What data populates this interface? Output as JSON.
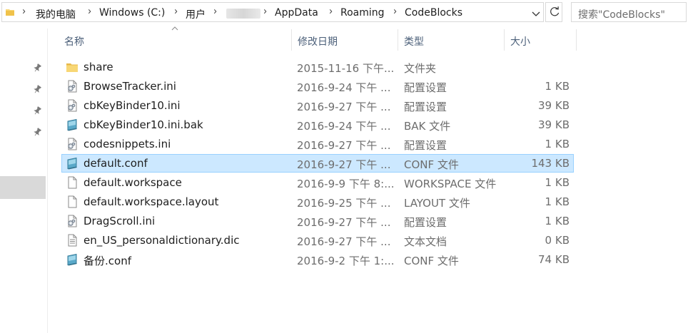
{
  "address_bar": {
    "crumbs": [
      "我的电脑",
      "Windows (C:)",
      "用户",
      "AppData",
      "Roaming",
      "CodeBlocks"
    ]
  },
  "search": {
    "placeholder": "搜索\"CodeBlocks\""
  },
  "columns": {
    "name": "名称",
    "date": "修改日期",
    "type": "类型",
    "size": "大小"
  },
  "files": [
    {
      "name": "share",
      "date": "2015-11-16 下午...",
      "type": "文件夹",
      "size": "",
      "icon": "folder-icon"
    },
    {
      "name": "BrowseTracker.ini",
      "date": "2016-9-24 下午 ...",
      "type": "配置设置",
      "size": "1 KB",
      "icon": "settings-file-icon"
    },
    {
      "name": "cbKeyBinder10.ini",
      "date": "2016-9-27 下午 ...",
      "type": "配置设置",
      "size": "39 KB",
      "icon": "settings-file-icon"
    },
    {
      "name": "cbKeyBinder10.ini.bak",
      "date": "2016-9-24 下午 ...",
      "type": "BAK 文件",
      "size": "39 KB",
      "icon": "open-with-file-icon"
    },
    {
      "name": "codesnippets.ini",
      "date": "2016-9-27 下午 ...",
      "type": "配置设置",
      "size": "1 KB",
      "icon": "settings-file-icon"
    },
    {
      "name": "default.conf",
      "date": "2016-9-27 下午 ...",
      "type": "CONF 文件",
      "size": "143 KB",
      "icon": "open-with-file-icon",
      "selected": true
    },
    {
      "name": "default.workspace",
      "date": "2016-9-9 下午 8:...",
      "type": "WORKSPACE 文件",
      "size": "1 KB",
      "icon": "blank-file-icon"
    },
    {
      "name": "default.workspace.layout",
      "date": "2016-9-25 下午 ...",
      "type": "LAYOUT 文件",
      "size": "1 KB",
      "icon": "blank-file-icon"
    },
    {
      "name": "DragScroll.ini",
      "date": "2016-9-27 下午 ...",
      "type": "配置设置",
      "size": "1 KB",
      "icon": "settings-file-icon"
    },
    {
      "name": "en_US_personaldictionary.dic",
      "date": "2016-9-27 下午 ...",
      "type": "文本文档",
      "size": "0 KB",
      "icon": "text-file-icon"
    },
    {
      "name": "备份.conf",
      "date": "2016-9-2 下午 1:...",
      "type": "CONF 文件",
      "size": "74 KB",
      "icon": "open-with-file-icon"
    }
  ],
  "colors": {
    "selection": "#cce8ff",
    "selection_border": "#99d1ff",
    "header_text": "#4c607a"
  }
}
